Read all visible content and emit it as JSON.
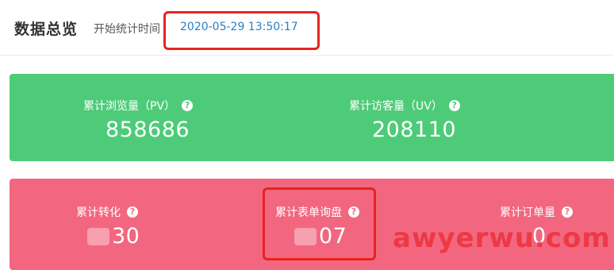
{
  "header": {
    "title": "数据总览",
    "start_time_label": "开始统计时间",
    "start_time_value": "2020-05-29 13:50:17"
  },
  "traffic_card": {
    "color": "#4ecb78",
    "metrics": [
      {
        "label": "累计浏览量（PV）",
        "value": "858686",
        "icon": "question-circle-icon"
      },
      {
        "label": "累计访客量（UV）",
        "value": "208110",
        "icon": "question-circle-icon"
      }
    ]
  },
  "business_card": {
    "color": "#f2677f",
    "metrics": [
      {
        "label": "累计转化",
        "value": "30",
        "icon": "question-circle-icon"
      },
      {
        "label": "累计表单询盘",
        "value": "07",
        "icon": "question-circle-icon"
      },
      {
        "label": "累计订单量",
        "value": "0",
        "icon": "question-circle-icon"
      }
    ]
  },
  "help_glyph": "?",
  "annotation_color": "#e8231f",
  "watermark": "awyerwu.com"
}
